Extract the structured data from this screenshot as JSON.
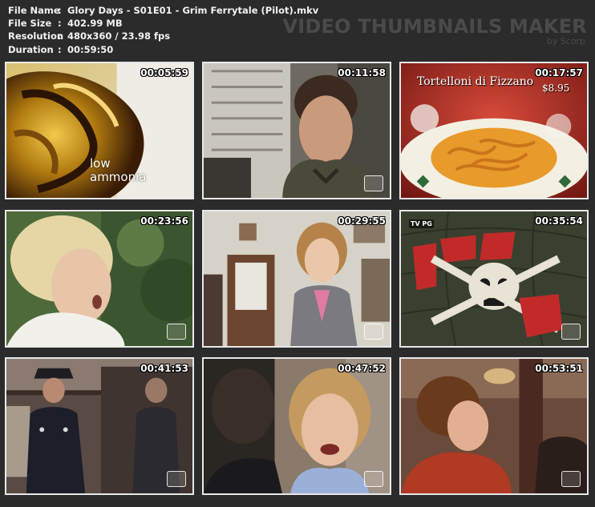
{
  "info": {
    "rows": [
      {
        "key": "File Name",
        "sep": ":",
        "value": "Glory Days - S01E01 - Grim Ferrytale (Pilot).mkv"
      },
      {
        "key": "File Size",
        "sep": ":",
        "value": "402.99 MB"
      },
      {
        "key": "Resolution",
        "sep": ":",
        "value": "480x360 / 23.98 fps"
      },
      {
        "key": "Duration",
        "sep": ":",
        "value": "00:59:50"
      }
    ]
  },
  "brand": {
    "title": "VIDEO THUMBNAILS MAKER",
    "byline": "by Scorp"
  },
  "thumbnails": [
    {
      "time": "00:05:59",
      "caption": "low\nammonia"
    },
    {
      "time": "00:11:58"
    },
    {
      "time": "00:17:57",
      "caption": "Tortelloni di Fizzano",
      "price": "$8.95"
    },
    {
      "time": "00:23:56"
    },
    {
      "time": "00:29:55"
    },
    {
      "time": "00:35:54",
      "rating": "TV PG"
    },
    {
      "time": "00:41:53"
    },
    {
      "time": "00:47:52"
    },
    {
      "time": "00:53:51"
    }
  ]
}
